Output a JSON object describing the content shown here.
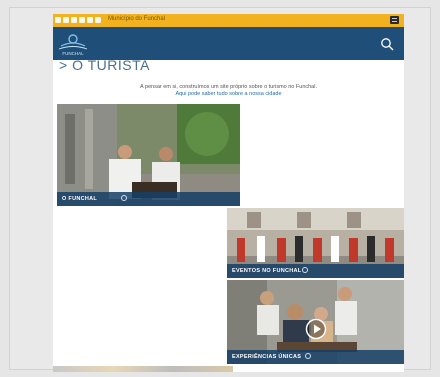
{
  "topbar": {
    "city_label": "Município do Funchal"
  },
  "header": {
    "logo_text": "FUNCHAL"
  },
  "page": {
    "title": "> O TURISTA",
    "intro": "A pensar em si, construímos um site próprio sobre o turismo no Funchal.",
    "intro_link": "Aqui pode saber tudo sobre a nossa cidade"
  },
  "cards": [
    {
      "label": "O FUNCHAL"
    },
    {
      "label": "EVENTOS NO FUNCHAL"
    },
    {
      "label": "EXPERIÊNCIAS ÚNICAS"
    }
  ],
  "colors": {
    "topbar": "#f2b21f",
    "header": "#1f4e79",
    "caption": "#163e66"
  },
  "icons": [
    "facebook-icon",
    "instagram-icon",
    "twitter-icon",
    "youtube-icon",
    "search-icon",
    "menu-icon",
    "info-icon",
    "play-icon"
  ]
}
